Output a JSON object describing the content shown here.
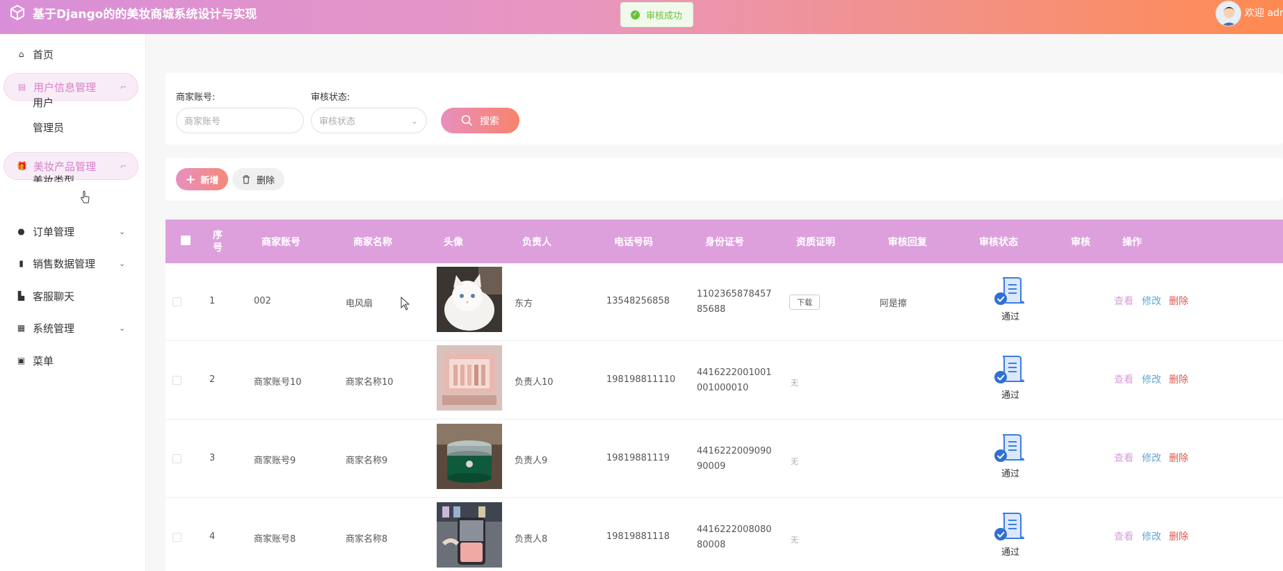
{
  "header": {
    "title": "基于Django的的美妆商城系统设计与实现",
    "toast": "审核成功",
    "welcome": "欢迎 adm"
  },
  "sidebar": {
    "items": [
      {
        "label": "首页",
        "icon": "home-icon"
      },
      {
        "label": "用户信息管理",
        "icon": "user-info-icon",
        "submenu": [
          "用户",
          "管理员"
        ]
      },
      {
        "label": "美妆产品管理",
        "icon": "gift-icon",
        "submenu": [
          "美妆类型"
        ]
      },
      {
        "label": "订单管理",
        "icon": "order-icon"
      },
      {
        "label": "销售数据管理",
        "icon": "book-icon"
      },
      {
        "label": "客服聊天",
        "icon": "chat-icon"
      },
      {
        "label": "系统管理",
        "icon": "building-icon"
      },
      {
        "label": "菜单",
        "icon": "menu-icon"
      }
    ]
  },
  "search": {
    "account_label": "商家账号:",
    "account_placeholder": "商家账号",
    "status_label": "审核状态:",
    "status_placeholder": "审核状态",
    "button": "搜索"
  },
  "actions": {
    "add": "新增",
    "delete": "删除"
  },
  "table": {
    "columns": [
      "序号",
      "商家账号",
      "商家名称",
      "头像",
      "负责人",
      "电话号码",
      "身份证号",
      "资质证明",
      "审核回复",
      "审核状态",
      "审核",
      "操作"
    ],
    "download_label": "下载",
    "none_label": "无",
    "ops": {
      "view": "查看",
      "edit": "修改",
      "delete": "删除"
    },
    "rows": [
      {
        "index": "1",
        "account": "002",
        "name": "电风扇",
        "manager": "东方",
        "phone": "13548256858",
        "id_no": "110236587845785688",
        "proof": "下载",
        "reply": "阿是擦",
        "status": "通过"
      },
      {
        "index": "2",
        "account": "商家账号10",
        "name": "商家名称10",
        "manager": "负责人10",
        "phone": "198198811110",
        "id_no": "4416222001001001000010",
        "proof": "无",
        "reply": "",
        "status": "通过"
      },
      {
        "index": "3",
        "account": "商家账号9",
        "name": "商家名称9",
        "manager": "负责人9",
        "phone": "19819881119",
        "id_no": "441622200909090009",
        "proof": "无",
        "reply": "",
        "status": "通过"
      },
      {
        "index": "4",
        "account": "商家账号8",
        "name": "商家名称8",
        "manager": "负责人8",
        "phone": "19819881118",
        "id_no": "441622200808080008",
        "proof": "无",
        "reply": "",
        "status": "通过"
      }
    ]
  },
  "colors": {
    "accent": "#dda0dd",
    "gradient_end": "#ff8a50",
    "edit": "#5fa8d3",
    "delete": "#e0564f"
  }
}
